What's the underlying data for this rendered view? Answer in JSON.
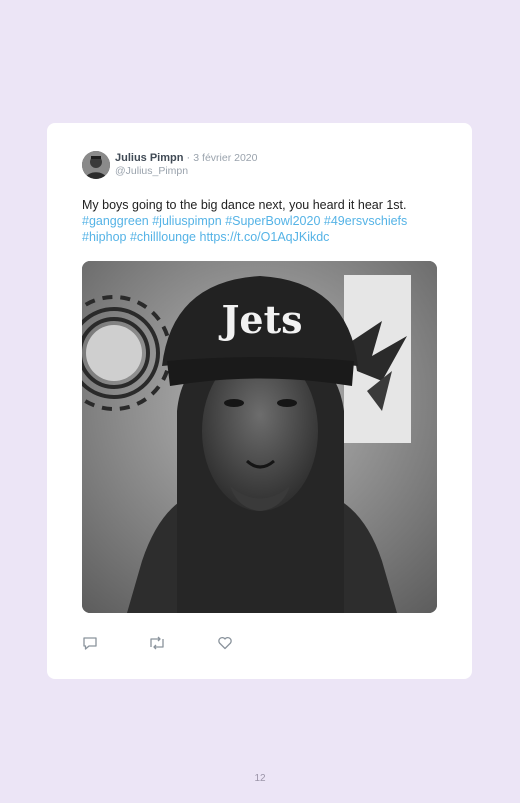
{
  "tweet": {
    "author_name": "Julius Pimpn",
    "separator": "·",
    "date": "3 février 2020",
    "handle": "@Julius_Pimpn",
    "text": "My boys going to the big dance next, you heard it hear 1st.",
    "hashtags_line1": [
      "#ganggreen",
      "#juliuspimpn",
      "#SuperBowl2020",
      "#49ersvschiefs"
    ],
    "hashtags_line2": [
      "#hiphop",
      "#chilllounge"
    ],
    "link": "https://t.co/O1AqJKikdc",
    "photo_cap_text": "Jets"
  },
  "actions": {
    "reply_icon": "reply-icon",
    "retweet_icon": "retweet-icon",
    "like_icon": "heart-icon"
  },
  "colors": {
    "page_background": "#ece5f6",
    "card_background": "#ffffff",
    "link": "#55b3e6",
    "muted": "#9aa3ad"
  },
  "page_number": "12"
}
